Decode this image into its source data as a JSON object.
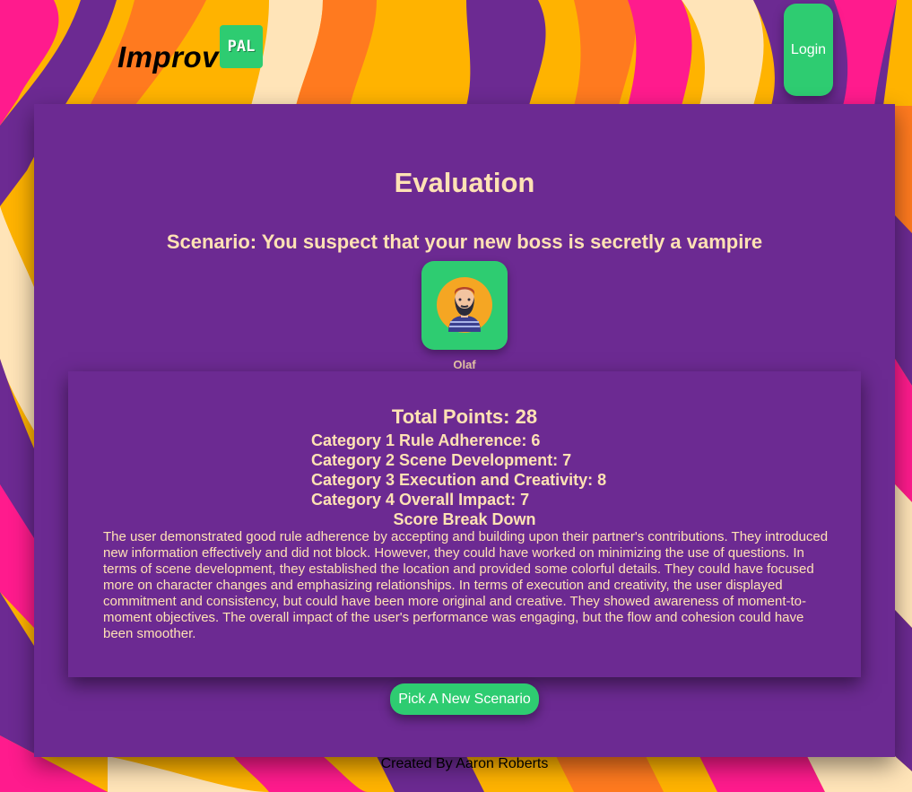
{
  "header": {
    "logo_text": "Improv",
    "logo_badge": "PAL",
    "login_label": "Login"
  },
  "evaluation": {
    "title": "Evaluation",
    "scenario": "Scenario: You suspect that your new boss is secretly a vampire",
    "partner": {
      "name": "Olaf",
      "avatar_icon": "bearded-man-avatar-icon"
    },
    "score": {
      "total": "Total Points: 28",
      "categories": [
        "Category 1 Rule Adherence: 6",
        "Category 2 Scene Development: 7",
        "Category 3 Execution and Creativity: 8",
        "Category 4 Overall Impact: 7"
      ],
      "breakdown_title": "Score Break Down",
      "breakdown_text": "The user demonstrated good rule adherence by accepting and building upon their partner's contributions. They introduced new information effectively and did not block. However, they could have worked on minimizing the use of questions. In terms of scene development, they established the location and provided some colorful details. They could have focused more on character changes and emphasizing relationships. In terms of execution and creativity, the user displayed commitment and consistency, but could have been more original and creative. They showed awareness of moment-to-moment objectives. The overall impact of the user's performance was engaging, but the flow and cohesion could have been smoother."
    },
    "new_scenario_label": "Pick A New Scenario"
  },
  "footer": {
    "credit": "Created By Aaron Roberts"
  },
  "colors": {
    "panel": "#6c2a92",
    "accent_green": "#2ecc71",
    "text_cream": "#ffe2b4",
    "bg_orange": "#ffb300",
    "bg_pink": "#ff1b8d",
    "bg_purple": "#6c2a92",
    "bg_cream": "#ffe4b8",
    "bg_deep_orange": "#ff7a1f"
  }
}
